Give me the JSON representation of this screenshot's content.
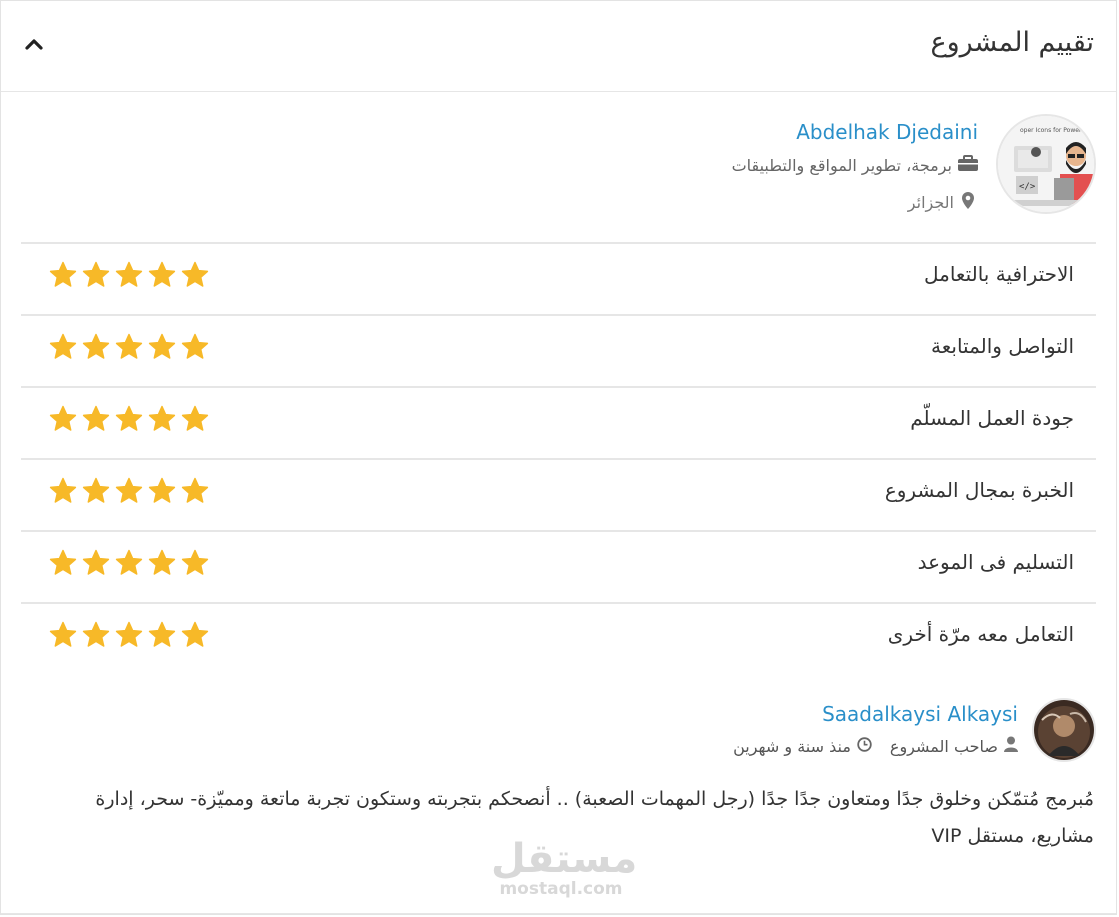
{
  "header": {
    "title": "تقييم المشروع"
  },
  "freelancer": {
    "name": "Abdelhak Djedaini",
    "skill": "برمجة، تطوير المواقع والتطبيقات",
    "location": "الجزائر",
    "avatar_caption": "oper Icons for Power"
  },
  "ratings": [
    {
      "label": "الاحترافية بالتعامل",
      "stars": 5,
      "max": 5
    },
    {
      "label": "التواصل والمتابعة",
      "stars": 5,
      "max": 5
    },
    {
      "label": "جودة العمل المسلّم",
      "stars": 5,
      "max": 5
    },
    {
      "label": "الخبرة بمجال المشروع",
      "stars": 5,
      "max": 5
    },
    {
      "label": "التسليم فى الموعد",
      "stars": 5,
      "max": 5
    },
    {
      "label": "التعامل معه مرّة أخرى",
      "stars": 5,
      "max": 5
    }
  ],
  "review": {
    "reviewer_name": "Saadalkaysi Alkaysi",
    "role": "صاحب المشروع",
    "time": "منذ سنة و شهرين",
    "text": "مُبرمج مُتمّكن وخلوق جدًا ومتعاون جدًا جدًا (رجل المهمات الصعبة) .. أنصحكم بتجربته وستكون تجربة ماتعة ومميّزة- سحر، إدارة مشاريع، مستقل VIP"
  },
  "watermark": {
    "arabic": "مستقل",
    "latin": "mostaql.com"
  },
  "colors": {
    "link": "#2a8fc9",
    "star": "#f7b928",
    "border": "#e6e6e6"
  },
  "icons": {
    "collapse": "chevron-up-icon",
    "skill": "briefcase-icon",
    "location": "map-marker-icon",
    "role": "user-icon",
    "time": "clock-icon",
    "star": "star-icon"
  }
}
